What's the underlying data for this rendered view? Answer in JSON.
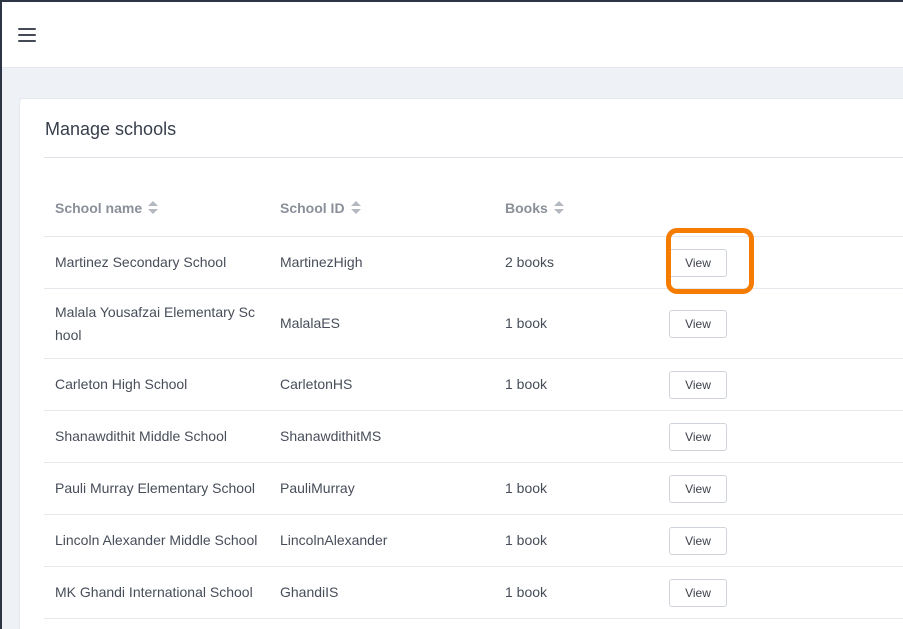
{
  "topbar": {
    "menu_icon": "hamburger-menu-icon"
  },
  "page": {
    "title": "Manage schools"
  },
  "table": {
    "columns": [
      {
        "label": "School name",
        "sort_icon": "sort-icon"
      },
      {
        "label": "School ID",
        "sort_icon": "sort-icon"
      },
      {
        "label": "Books",
        "sort_icon": "sort-icon"
      },
      {
        "label": ""
      }
    ],
    "rows": [
      {
        "name": "Martinez Secondary School",
        "id": "MartinezHigh",
        "books": "2 books",
        "action": "View"
      },
      {
        "name": "Malala Yousafzai Elementary School",
        "id": "MalalaES",
        "books": "1 book",
        "action": "View"
      },
      {
        "name": "Carleton High School",
        "id": "CarletonHS",
        "books": "1 book",
        "action": "View"
      },
      {
        "name": "Shanawdithit Middle School",
        "id": "ShanawdithitMS",
        "books": "",
        "action": "View"
      },
      {
        "name": "Pauli Murray Elementary School",
        "id": "PauliMurray",
        "books": "1 book",
        "action": "View"
      },
      {
        "name": "Lincoln Alexander Middle School",
        "id": "LincolnAlexander",
        "books": "1 book",
        "action": "View"
      },
      {
        "name": "MK Ghandi International School",
        "id": "GhandiIS",
        "books": "1 book",
        "action": "View"
      }
    ]
  },
  "annotation": {
    "highlight_color": "#f57c00",
    "highlighted_row": 0
  }
}
